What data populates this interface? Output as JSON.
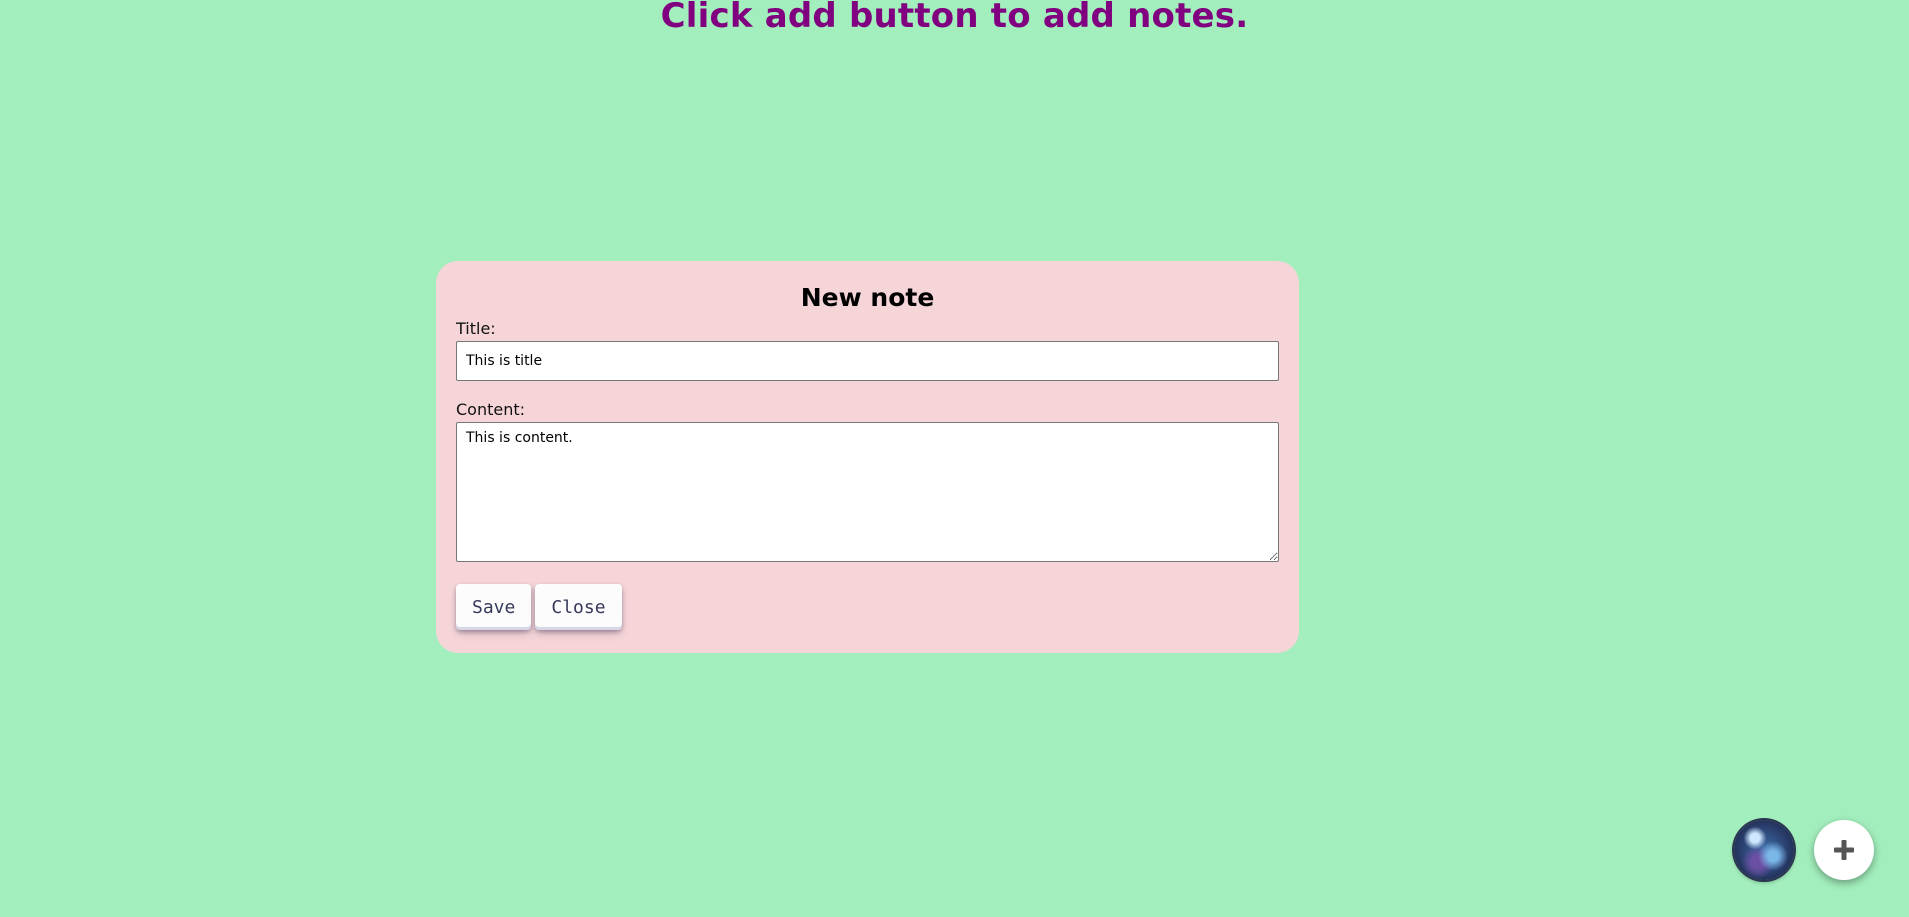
{
  "page": {
    "heading": "Click add button to add notes."
  },
  "modal": {
    "title": "New note",
    "title_label": "Title:",
    "title_value": "This is title",
    "content_label": "Content:",
    "content_value": "This is content.",
    "save_label": "Save",
    "close_label": "Close"
  },
  "fab": {
    "avatar_icon": "globe-avatar-icon",
    "add_icon": "plus-icon"
  },
  "colors": {
    "background": "#a2eebc",
    "heading": "#800080",
    "modal_background": "#f5d5d8"
  }
}
